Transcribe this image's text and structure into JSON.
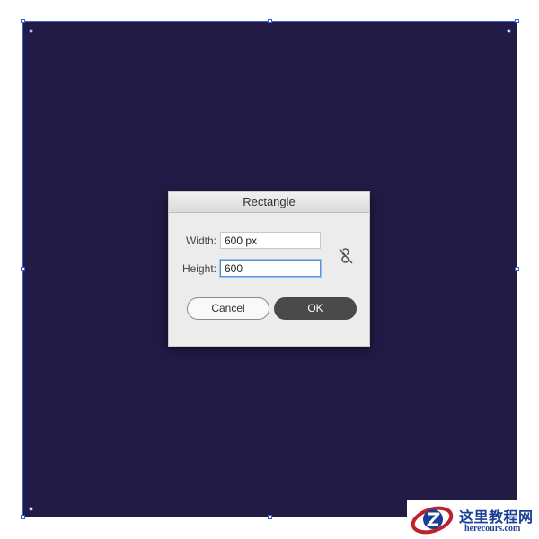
{
  "canvas": {
    "shape_fill": "#211b45",
    "selection_color": "#3c5fd8"
  },
  "dialog": {
    "title": "Rectangle",
    "width_label": "Width:",
    "width_value": "600 px",
    "height_label": "Height:",
    "height_value": "600",
    "constrain_icon": "unlink-icon",
    "cancel_label": "Cancel",
    "ok_label": "OK"
  },
  "watermark": {
    "title": "这里教程网",
    "url": "herecours.com"
  }
}
